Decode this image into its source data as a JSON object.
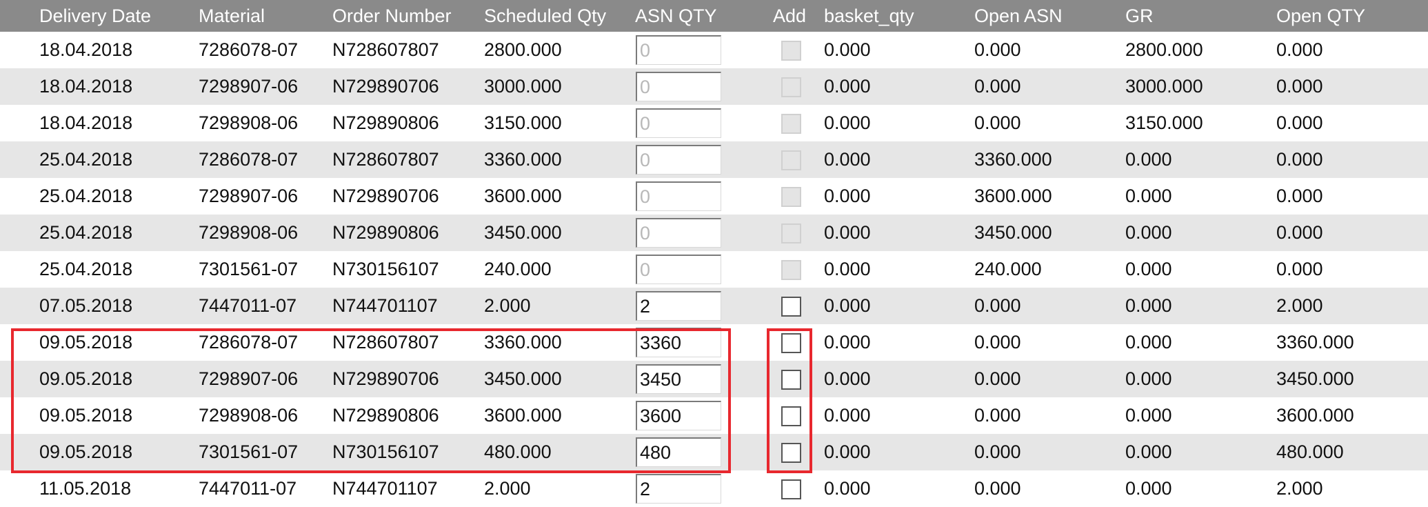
{
  "columns": {
    "delivery_date": "Delivery Date",
    "material": "Material",
    "order_number": "Order Number",
    "scheduled_qty": "Scheduled Qty",
    "asn_qty": "ASN QTY",
    "add": "Add",
    "basket_qty": "basket_qty",
    "open_asn": "Open ASN",
    "gr": "GR",
    "open_qty": "Open QTY"
  },
  "rows": [
    {
      "delivery_date": "18.04.2018",
      "material": "7286078-07",
      "order_number": "N728607807",
      "scheduled_qty": "2800.000",
      "asn_qty": "0",
      "asn_enabled": false,
      "add_enabled": false,
      "basket_qty": "0.000",
      "open_asn": "0.000",
      "gr": "2800.000",
      "open_qty": "0.000"
    },
    {
      "delivery_date": "18.04.2018",
      "material": "7298907-06",
      "order_number": "N729890706",
      "scheduled_qty": "3000.000",
      "asn_qty": "0",
      "asn_enabled": false,
      "add_enabled": false,
      "basket_qty": "0.000",
      "open_asn": "0.000",
      "gr": "3000.000",
      "open_qty": "0.000"
    },
    {
      "delivery_date": "18.04.2018",
      "material": "7298908-06",
      "order_number": "N729890806",
      "scheduled_qty": "3150.000",
      "asn_qty": "0",
      "asn_enabled": false,
      "add_enabled": false,
      "basket_qty": "0.000",
      "open_asn": "0.000",
      "gr": "3150.000",
      "open_qty": "0.000"
    },
    {
      "delivery_date": "25.04.2018",
      "material": "7286078-07",
      "order_number": "N728607807",
      "scheduled_qty": "3360.000",
      "asn_qty": "0",
      "asn_enabled": false,
      "add_enabled": false,
      "basket_qty": "0.000",
      "open_asn": "3360.000",
      "gr": "0.000",
      "open_qty": "0.000"
    },
    {
      "delivery_date": "25.04.2018",
      "material": "7298907-06",
      "order_number": "N729890706",
      "scheduled_qty": "3600.000",
      "asn_qty": "0",
      "asn_enabled": false,
      "add_enabled": false,
      "basket_qty": "0.000",
      "open_asn": "3600.000",
      "gr": "0.000",
      "open_qty": "0.000"
    },
    {
      "delivery_date": "25.04.2018",
      "material": "7298908-06",
      "order_number": "N729890806",
      "scheduled_qty": "3450.000",
      "asn_qty": "0",
      "asn_enabled": false,
      "add_enabled": false,
      "basket_qty": "0.000",
      "open_asn": "3450.000",
      "gr": "0.000",
      "open_qty": "0.000"
    },
    {
      "delivery_date": "25.04.2018",
      "material": "7301561-07",
      "order_number": "N730156107",
      "scheduled_qty": "240.000",
      "asn_qty": "0",
      "asn_enabled": false,
      "add_enabled": false,
      "basket_qty": "0.000",
      "open_asn": "240.000",
      "gr": "0.000",
      "open_qty": "0.000"
    },
    {
      "delivery_date": "07.05.2018",
      "material": "7447011-07",
      "order_number": "N744701107",
      "scheduled_qty": "2.000",
      "asn_qty": "2",
      "asn_enabled": true,
      "add_enabled": true,
      "basket_qty": "0.000",
      "open_asn": "0.000",
      "gr": "0.000",
      "open_qty": "2.000"
    },
    {
      "delivery_date": "09.05.2018",
      "material": "7286078-07",
      "order_number": "N728607807",
      "scheduled_qty": "3360.000",
      "asn_qty": "3360",
      "asn_enabled": true,
      "add_enabled": true,
      "basket_qty": "0.000",
      "open_asn": "0.000",
      "gr": "0.000",
      "open_qty": "3360.000"
    },
    {
      "delivery_date": "09.05.2018",
      "material": "7298907-06",
      "order_number": "N729890706",
      "scheduled_qty": "3450.000",
      "asn_qty": "3450",
      "asn_enabled": true,
      "add_enabled": true,
      "basket_qty": "0.000",
      "open_asn": "0.000",
      "gr": "0.000",
      "open_qty": "3450.000"
    },
    {
      "delivery_date": "09.05.2018",
      "material": "7298908-06",
      "order_number": "N729890806",
      "scheduled_qty": "3600.000",
      "asn_qty": "3600",
      "asn_enabled": true,
      "add_enabled": true,
      "basket_qty": "0.000",
      "open_asn": "0.000",
      "gr": "0.000",
      "open_qty": "3600.000"
    },
    {
      "delivery_date": "09.05.2018",
      "material": "7301561-07",
      "order_number": "N730156107",
      "scheduled_qty": "480.000",
      "asn_qty": "480",
      "asn_enabled": true,
      "add_enabled": true,
      "basket_qty": "0.000",
      "open_asn": "0.000",
      "gr": "0.000",
      "open_qty": "480.000"
    },
    {
      "delivery_date": "11.05.2018",
      "material": "7447011-07",
      "order_number": "N744701107",
      "scheduled_qty": "2.000",
      "asn_qty": "2",
      "asn_enabled": true,
      "add_enabled": true,
      "basket_qty": "0.000",
      "open_asn": "0.000",
      "gr": "0.000",
      "open_qty": "2.000"
    }
  ],
  "colors": {
    "header_bg": "#8a8a8a",
    "row_alt_bg": "#e6e6e6",
    "highlight": "#e8282e"
  }
}
